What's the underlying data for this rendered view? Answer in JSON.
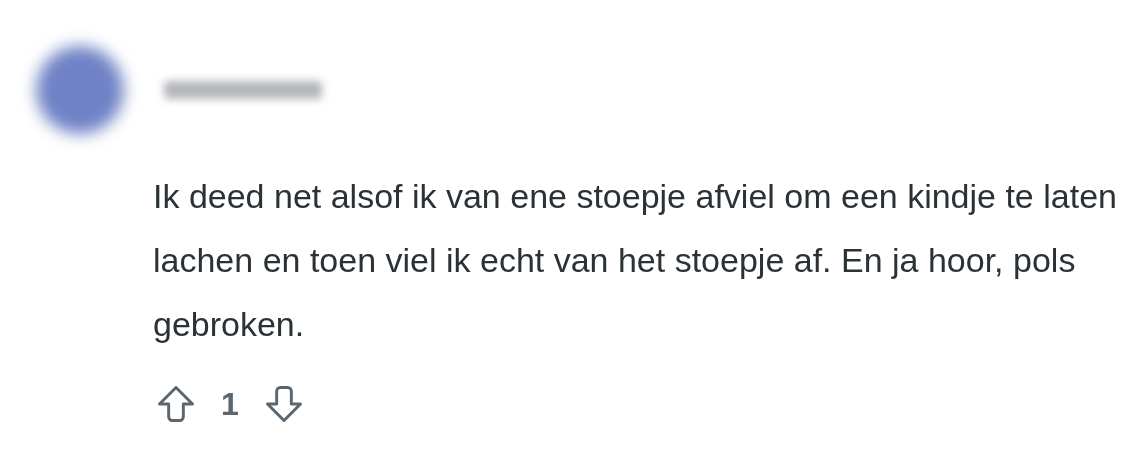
{
  "comment": {
    "body": "Ik deed net alsof ik van ene stoepje afviel om een kindje te laten lachen en toen viel ik echt van het stoepje af. En ja hoor, pols gebroken.",
    "score": "1"
  }
}
